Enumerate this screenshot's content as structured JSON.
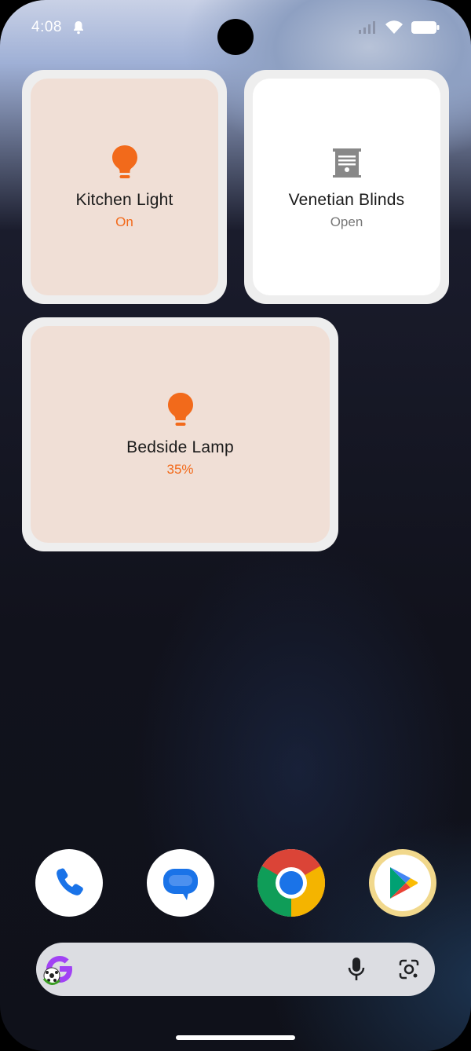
{
  "status_bar": {
    "time": "4:08"
  },
  "tiles": [
    {
      "name": "Kitchen Light",
      "state": "On",
      "icon": "lightbulb-icon",
      "active": true
    },
    {
      "name": "Venetian Blinds",
      "state": "Open",
      "icon": "blinds-icon",
      "active": false
    },
    {
      "name": "Bedside Lamp",
      "state": "35%",
      "icon": "lightbulb-icon",
      "active": true
    }
  ],
  "dock": [
    "phone-icon",
    "messages-icon",
    "chrome-icon",
    "play-store-icon"
  ],
  "search": {
    "left_icon": "google-icon",
    "mic": "mic-icon",
    "lens": "lens-icon"
  },
  "colors": {
    "accent_orange": "#f26a1b",
    "tile_on_bg": "#f0dfd6",
    "tile_off_bg": "#ffffff"
  }
}
